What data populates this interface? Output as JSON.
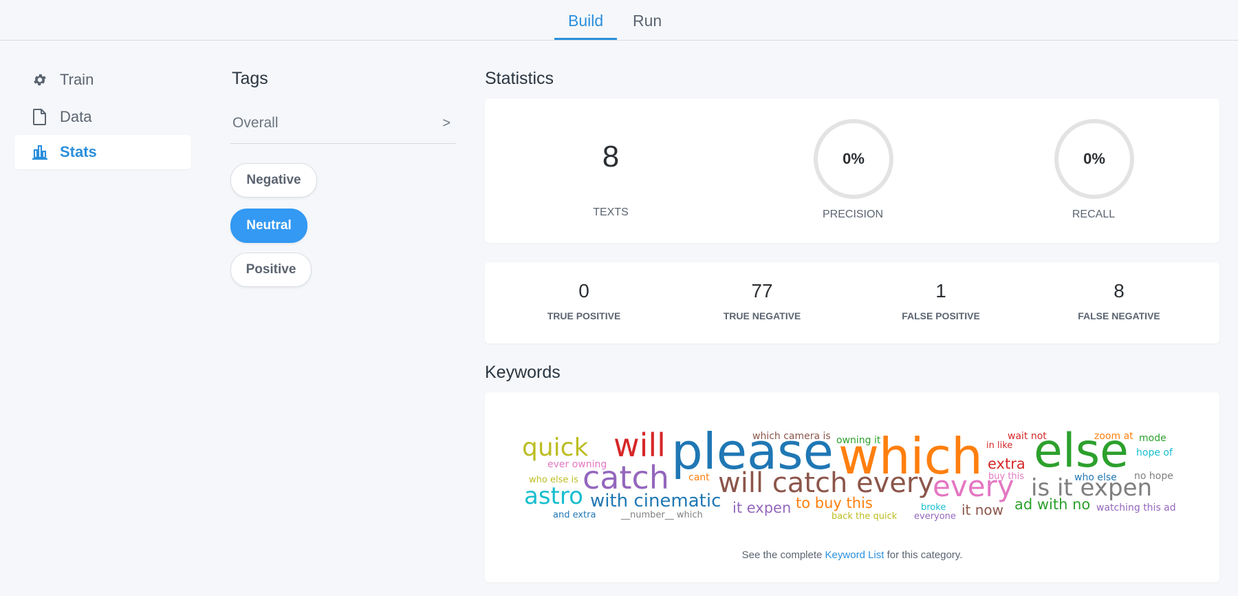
{
  "nav": {
    "tabs": [
      "Build",
      "Run"
    ]
  },
  "sidebar": {
    "items": [
      {
        "label": "Train",
        "icon": "gear-icon"
      },
      {
        "label": "Data",
        "icon": "document-icon"
      },
      {
        "label": "Stats",
        "icon": "bar-chart-icon"
      }
    ]
  },
  "tags": {
    "title": "Tags",
    "overall": "Overall",
    "chevron": ">",
    "pills": [
      "Negative",
      "Neutral",
      "Positive"
    ]
  },
  "statistics": {
    "title": "Statistics",
    "texts_value": "8",
    "texts_label": "TEXTS",
    "precision_value": "0%",
    "precision_label": "PRECISION",
    "recall_value": "0%",
    "recall_label": "RECALL"
  },
  "confusion": {
    "true_positive": "0",
    "true_positive_label": "TRUE POSITIVE",
    "true_negative": "77",
    "true_negative_label": "TRUE NEGATIVE",
    "false_positive": "1",
    "false_positive_label": "FALSE POSITIVE",
    "false_negative": "8",
    "false_negative_label": "FALSE NEGATIVE"
  },
  "keywords": {
    "title": "Keywords",
    "words": [
      "quick",
      "ever owning",
      "who else is",
      "astro",
      "and extra",
      "will",
      "catch",
      "cant",
      "with cinematic",
      "__number__ which",
      "please",
      "which camera is",
      "will catch every",
      "it expen",
      "to buy this",
      "back the quick",
      "owning it",
      "which",
      "broke",
      "everyone",
      "every",
      "in like",
      "wait not",
      "extra",
      "buy this",
      "it now",
      "is it expen",
      "who else",
      "else",
      "zoom at",
      "mode",
      "hope of",
      "no hope",
      "ad with no",
      "watching this ad"
    ],
    "footnote_pre": "See the complete ",
    "footnote_link": "Keyword List",
    "footnote_post": " for this category."
  },
  "colors": {
    "accent": "#2a8fdc",
    "pill_active": "#3399f3"
  }
}
